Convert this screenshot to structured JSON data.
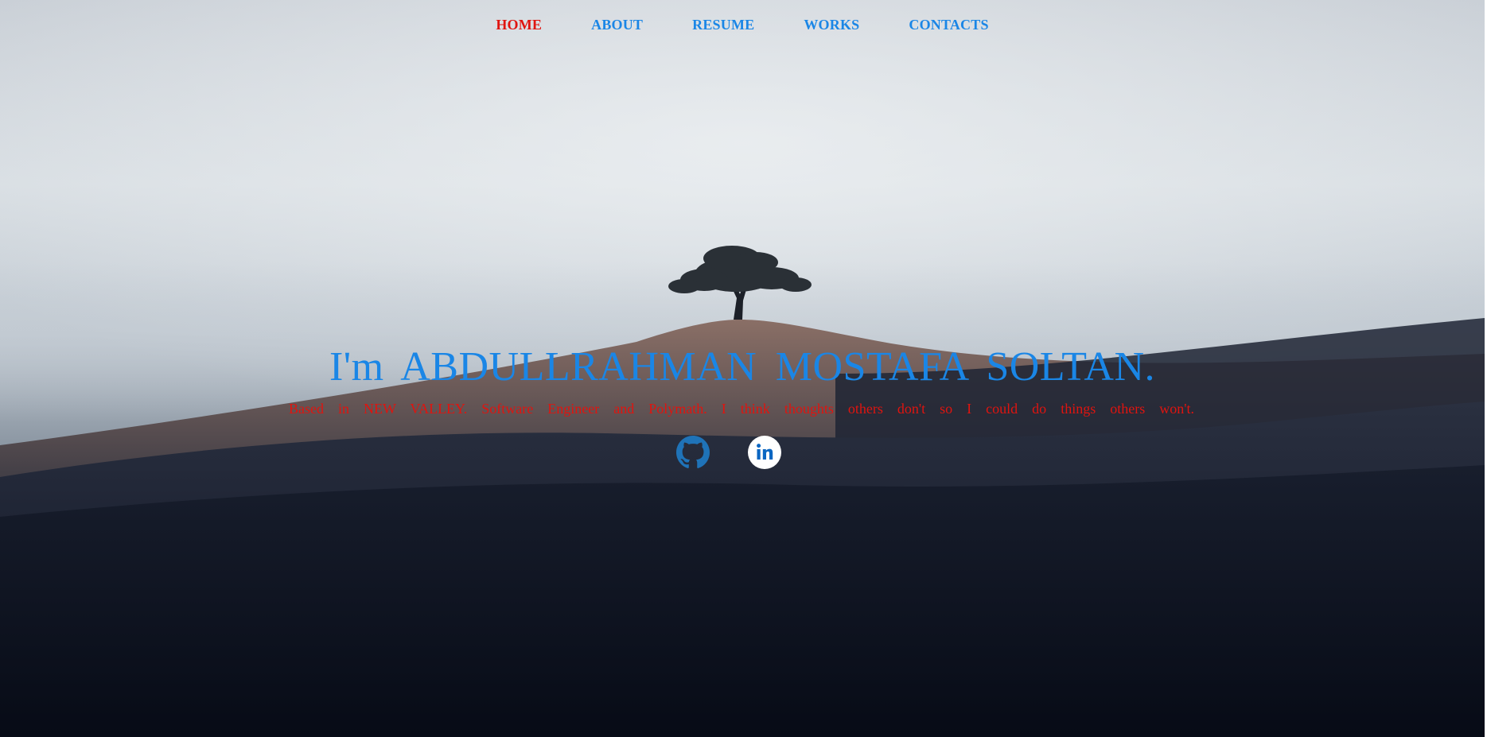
{
  "nav": {
    "items": [
      {
        "label": "HOME",
        "active": true
      },
      {
        "label": "ABOUT",
        "active": false
      },
      {
        "label": "RESUME",
        "active": false
      },
      {
        "label": "WORKS",
        "active": false
      },
      {
        "label": "CONTACTS",
        "active": false
      }
    ]
  },
  "hero": {
    "headline": "I'm ABDULLRAHMAN MOSTAFA SOLTAN.",
    "tagline": "Based in NEW VALLEY. Software Engineer and Polymath. I think thoughts others don't so I could do things others won't."
  },
  "socials": {
    "items": [
      {
        "icon": "github-icon"
      },
      {
        "icon": "linkedin-icon"
      }
    ]
  },
  "colors": {
    "accent": "#1a86e6",
    "active": "#e0140f",
    "tagline": "#e0140f"
  }
}
